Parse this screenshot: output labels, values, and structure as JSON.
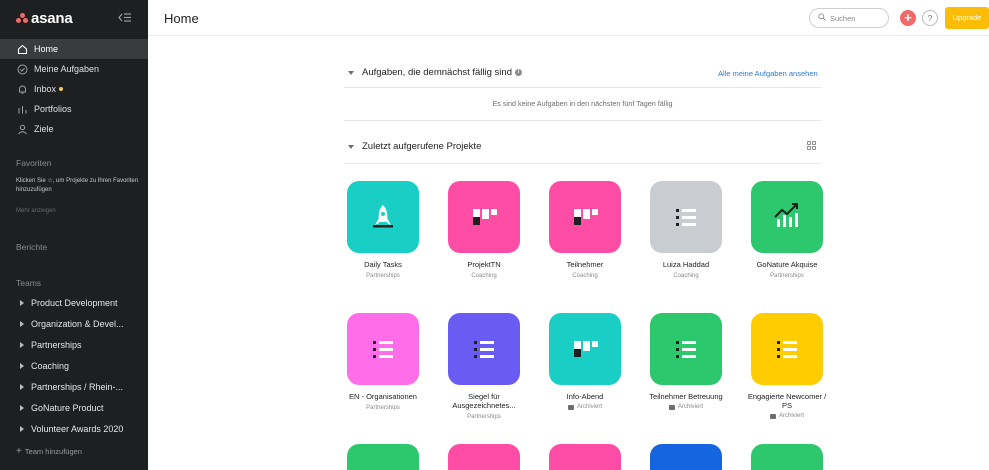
{
  "brand": {
    "name": "asana",
    "logo_color": "#f06a6a"
  },
  "sidebar": {
    "nav": [
      {
        "label": "Home",
        "icon": "home-icon",
        "active": true
      },
      {
        "label": "Meine Aufgaben",
        "icon": "check-circle-icon"
      },
      {
        "label": "Inbox",
        "icon": "bell-icon",
        "badge": true
      },
      {
        "label": "Portfolios",
        "icon": "bar-chart-icon"
      },
      {
        "label": "Ziele",
        "icon": "person-icon"
      }
    ],
    "favorites_title": "Favoriten",
    "favorites_hint": "Klicken Sie ☆, um Projekte zu Ihren Favoriten hinzuzufügen",
    "favorites_more": "Mehr anzeigen",
    "reports_title": "Berichte",
    "teams_title": "Teams",
    "teams": [
      "Product Development",
      "Organization & Devel...",
      "Partnerships",
      "Coaching",
      "Partnerships / Rhein-...",
      "GoNature Product",
      "Volunteer Awards 2020"
    ],
    "add_team": "Team hinzufügen"
  },
  "header": {
    "title": "Home",
    "search_placeholder": "Suchen",
    "help": "?",
    "upgrade": "Upgrade",
    "upgrade_color": "#fbbc05"
  },
  "tasks_section": {
    "title": "Aufgaben, die demnächst fällig sind",
    "see_all": "Alle meine Aufgaben ansehen",
    "empty": "Es sind keine Aufgaben in den nächsten fünf Tagen fällig"
  },
  "projects_section": {
    "title": "Zuletzt aufgerufene Projekte",
    "projects": [
      {
        "name": "Daily Tasks",
        "team": "Partnerships",
        "color": "#19cfc5",
        "icon": "rocket-icon"
      },
      {
        "name": "ProjektTN",
        "team": "Coaching",
        "color": "#ff4da6",
        "icon": "board-icon"
      },
      {
        "name": "Teilnehmer",
        "team": "Coaching",
        "color": "#ff4da6",
        "icon": "board-icon"
      },
      {
        "name": "Luiza Haddad",
        "team": "Coaching",
        "color": "#c9ccd1",
        "icon": "list-icon"
      },
      {
        "name": "GoNature Akquise",
        "team": "Partnerships",
        "color": "#2dc76d",
        "icon": "growth-chart-icon"
      },
      {
        "name": "EN - Organisationen",
        "team": "Partnerships",
        "color": "#ff6ee8",
        "icon": "list-icon"
      },
      {
        "name": "Siegel für Ausgezeichnetes...",
        "team": "Partnerships",
        "color": "#6a5cf2",
        "icon": "list-icon"
      },
      {
        "name": "Info-Abend",
        "team": "Archiviert",
        "color": "#19cfc5",
        "icon": "board-icon",
        "archived": true
      },
      {
        "name": "Teilnehmer Betreuung",
        "team": "Archiviert",
        "color": "#2dc76d",
        "icon": "list-icon",
        "archived": true
      },
      {
        "name": "Engagierte Newcomer / PS",
        "team": "Archiviert",
        "color": "#ffcc00",
        "icon": "list-icon",
        "archived": true
      }
    ],
    "partial_row_colors": [
      "#2dc76d",
      "#ff4da6",
      "#ff4da6",
      "#1565e0",
      "#2dc76d"
    ]
  }
}
